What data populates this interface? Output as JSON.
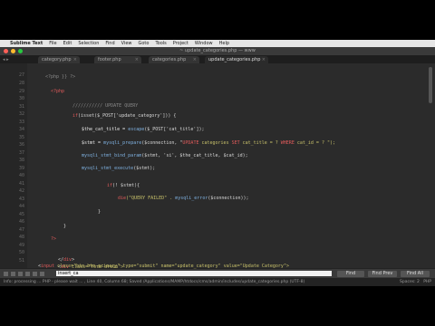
{
  "menubar": {
    "apple": "",
    "app": "Sublime Text",
    "items": [
      "File",
      "Edit",
      "Selection",
      "Find",
      "View",
      "Goto",
      "Tools",
      "Project",
      "Window",
      "Help"
    ]
  },
  "window": {
    "title": "~ update_categories.php — www"
  },
  "tabs": [
    {
      "label": "category.php",
      "active": false
    },
    {
      "label": "footer.php",
      "active": false
    },
    {
      "label": "categories.php",
      "active": false
    },
    {
      "label": "update_categories.php",
      "active": true
    }
  ],
  "line_numbers": [
    "27",
    "28",
    "29",
    "30",
    "31",
    "32",
    "33",
    "34",
    "35",
    "36",
    "37",
    "38",
    "39",
    "40",
    "41",
    "42",
    "43",
    "44",
    "45",
    "46",
    "47",
    "48",
    "49",
    "50",
    "51",
    "52",
    "53",
    "54"
  ],
  "code": {
    "l1": "<?php }} ?>",
    "l2": "<?php",
    "l3": "/////////// UPDATE QUERY",
    "l4a": "if",
    "l4b": "(isset($_POST['update_category'])) {",
    "l5a": "$the_cat_title = ",
    "l5b": "escape",
    "l5c": "($_POST['cat_title']);",
    "l6a": "$stmt = ",
    "l6b": "mysqli_prepare",
    "l6c": "($connection, \"",
    "l6d": "UPDATE",
    "l6e": " categories ",
    "l6f": "SET",
    "l6g": " cat_title = ? ",
    "l6h": "WHERE",
    "l6i": " cat_id = ? \");",
    "l7a": "mysqli_stmt_bind_param",
    "l7b": "($stmt, 'si', $the_cat_title, $cat_id);",
    "l8a": "mysqli_stmt_execute",
    "l8b": "($stmt);",
    "l9a": "if",
    "l9b": "(! $stmt){",
    "l10a": "die",
    "l10b": "(\"QUERY FAILED\" . ",
    "l10c": "mysqli_error",
    "l10d": "($connection));",
    "l11": "}",
    "l12": "}",
    "l13": "?>",
    "l14a": "</",
    "l14b": "div",
    "l14c": ">",
    "l15a": "<",
    "l15b": "div",
    "l15c": " class=\"form-group\">",
    "l16a": "<",
    "l16b": "input",
    "l16c": " class=\"btn btn-primary\" type=\"submit\" name=\"update_category\" value=\"Update Category\">",
    "l17a": "</",
    "l17b": "div",
    "l17c": ">"
  },
  "findbar": {
    "value": "insert_ca",
    "find_label": "Find",
    "find_prev_label": "Find Prev",
    "find_all_label": "Find All"
  },
  "status": {
    "left": "Info: processing ... PHP - please wait ... , Line 40, Column 68; Saved /Applications/MAMP/htdocs/cms/admin/includes/update_categories.php (UTF-8)",
    "spaces": "Spaces: 2",
    "syntax": "PHP"
  }
}
